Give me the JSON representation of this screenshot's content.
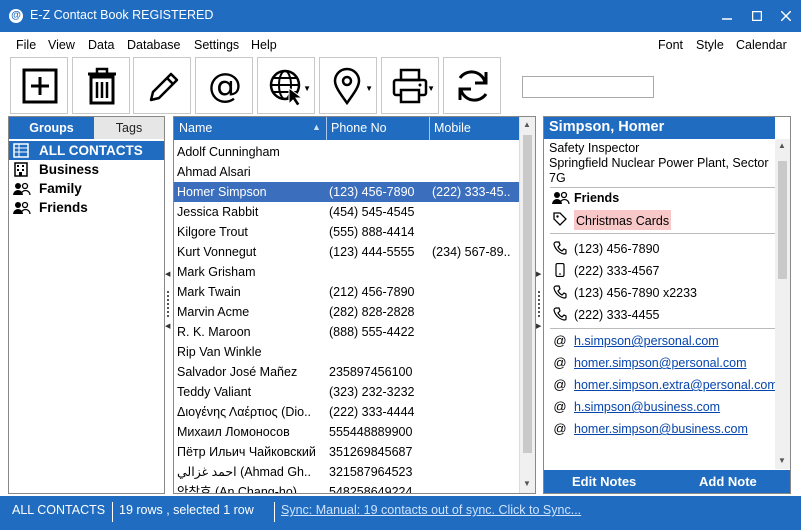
{
  "window": {
    "title": "E-Z Contact Book REGISTERED",
    "app_icon": "@"
  },
  "menu": {
    "left": [
      "File",
      "View",
      "Data",
      "Database",
      "Settings",
      "Help"
    ],
    "right": [
      "Font",
      "Style",
      "Calendar"
    ]
  },
  "toolbar": {
    "buttons": [
      "add-contact",
      "delete-contact",
      "edit-contact",
      "email",
      "web",
      "map",
      "print",
      "sync"
    ],
    "search_value": ""
  },
  "left_pane": {
    "tabs": {
      "groups": "Groups",
      "tags": "Tags"
    },
    "groups": [
      "ALL CONTACTS",
      "Business",
      "Family",
      "Friends"
    ],
    "selected_group": "ALL CONTACTS"
  },
  "grid": {
    "columns": {
      "name": "Name",
      "phone": "Phone No",
      "mobile": "Mobile"
    },
    "rows": [
      {
        "name": "Adolf Cunningham",
        "phone": "",
        "mobile": ""
      },
      {
        "name": "Ahmad Alsari",
        "phone": "",
        "mobile": ""
      },
      {
        "name": "Homer Simpson",
        "phone": "(123) 456-7890",
        "mobile": "(222) 333-45.."
      },
      {
        "name": "Jessica Rabbit",
        "phone": "(454) 545-4545",
        "mobile": ""
      },
      {
        "name": "Kilgore Trout",
        "phone": "(555) 888-4414",
        "mobile": ""
      },
      {
        "name": "Kurt Vonnegut",
        "phone": "(123) 444-5555",
        "mobile": "(234) 567-89.."
      },
      {
        "name": "Mark Grisham",
        "phone": "",
        "mobile": ""
      },
      {
        "name": "Mark Twain",
        "phone": "(212) 456-7890",
        "mobile": ""
      },
      {
        "name": "Marvin Acme",
        "phone": "(282) 828-2828",
        "mobile": ""
      },
      {
        "name": "R. K. Maroon",
        "phone": "(888) 555-4422",
        "mobile": ""
      },
      {
        "name": "Rip Van Winkle",
        "phone": "",
        "mobile": ""
      },
      {
        "name": "Salvador José Mañez",
        "phone": "235897456100",
        "mobile": ""
      },
      {
        "name": "Teddy Valiant",
        "phone": "(323) 232-3232",
        "mobile": ""
      },
      {
        "name": "Διογένης Λαέρτιος (Dio..",
        "phone": "(222) 333-4444",
        "mobile": ""
      },
      {
        "name": "Михаил Ломоносов",
        "phone": "555448889900",
        "mobile": ""
      },
      {
        "name": "Пётр Ильич Чайковский",
        "phone": "351269845687",
        "mobile": ""
      },
      {
        "name": "احمد غزالي (Ahmad Gh..",
        "phone": "321587964523",
        "mobile": ""
      },
      {
        "name": "안창호 (An Chang-ho)",
        "phone": "548258649224",
        "mobile": ""
      }
    ],
    "selected_row": 2
  },
  "detail": {
    "name": "Simpson, Homer",
    "job_title": "Safety Inspector",
    "company_line1": "Springfield Nuclear Power Plant, Sector",
    "company_line2": "7G",
    "group": "Friends",
    "tag": "Christmas Cards",
    "phones": [
      {
        "icon": "phone-icon",
        "value": "(123) 456-7890"
      },
      {
        "icon": "mobile-icon",
        "value": "(222) 333-4567"
      },
      {
        "icon": "phone-icon",
        "value": "(123) 456-7890 x2233"
      },
      {
        "icon": "phone-icon",
        "value": "(222) 333-4455"
      }
    ],
    "emails": [
      "h.simpson@personal.com",
      "homer.simpson@personal.com",
      "homer.simpson.extra@personal.com",
      "h.simpson@business.com",
      "homer.simpson@business.com"
    ],
    "buttons": {
      "edit_notes": "Edit Notes",
      "add_note": "Add Note"
    }
  },
  "status": {
    "filter": "ALL CONTACTS",
    "rows": "19 rows , selected 1 row",
    "sync": "Sync: Manual: 19 contacts out of sync. Click to Sync..."
  },
  "colors": {
    "accent": "#1f6cc1",
    "selected_row": "#3b6fbd",
    "tag_bg": "#f8c8c8",
    "link": "#0645ad"
  }
}
